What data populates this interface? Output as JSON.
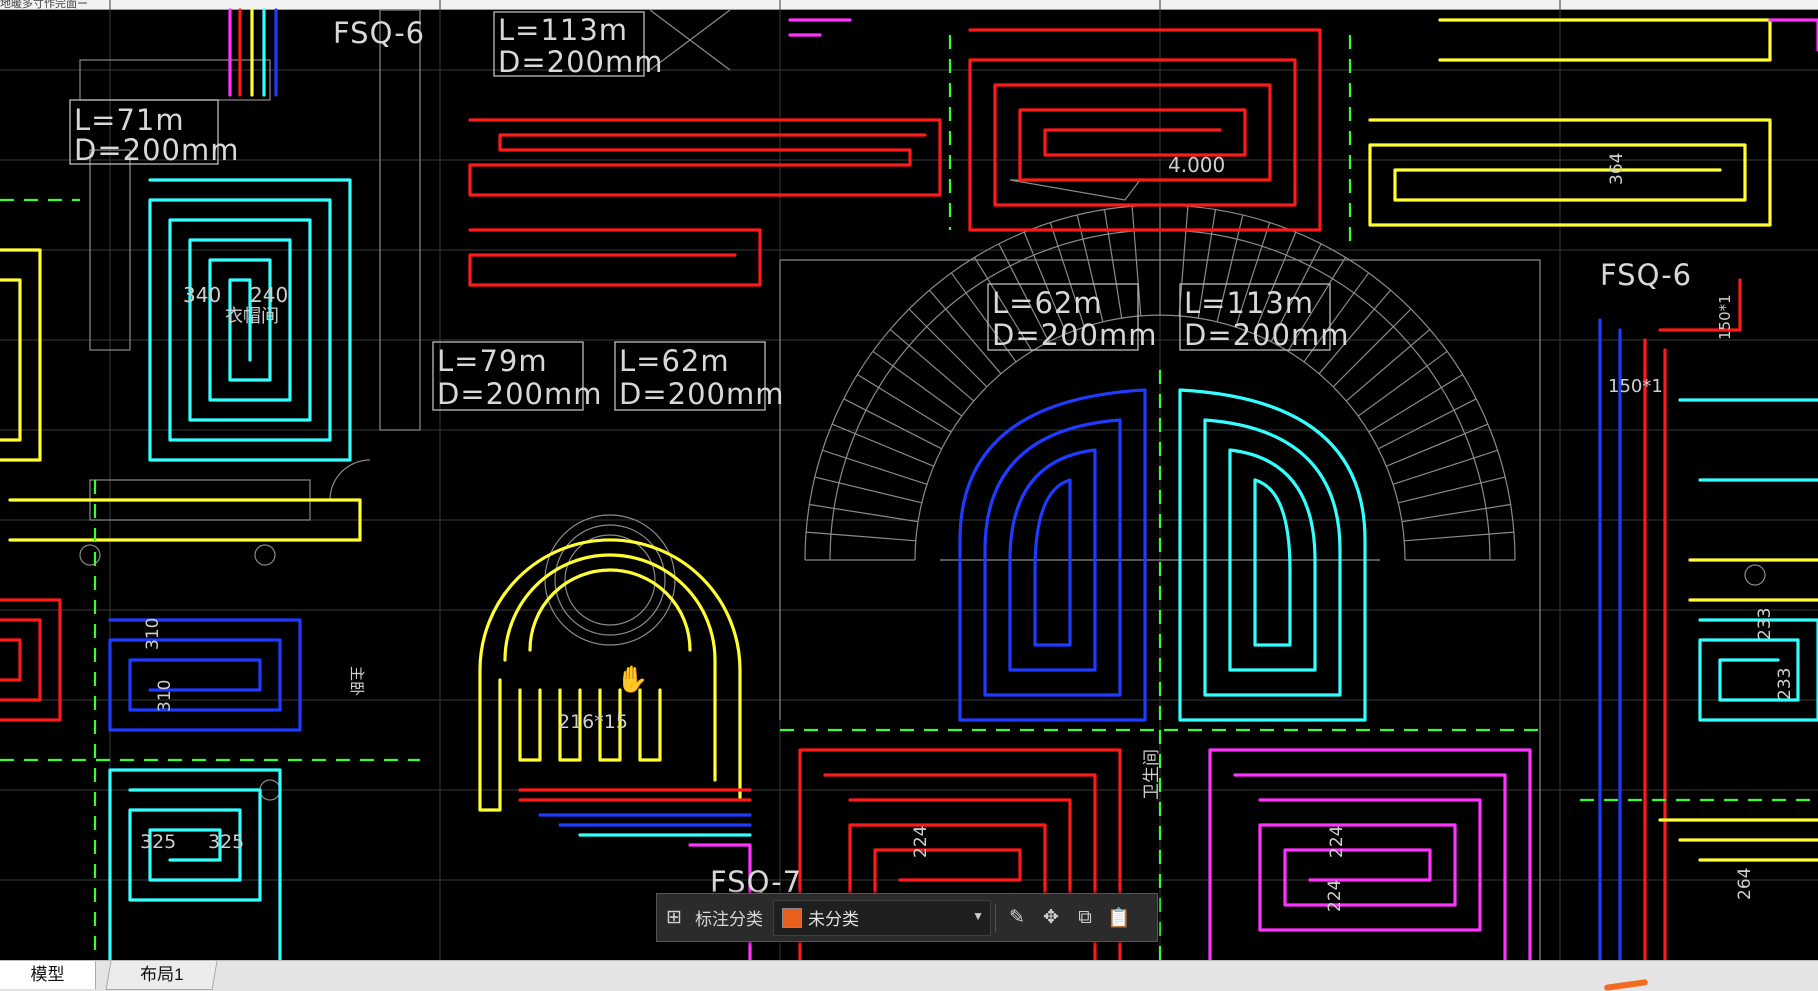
{
  "window": {
    "title_fragment": "地暖多寸作完面ー"
  },
  "drawing": {
    "labels": [
      {
        "length": "L=71m",
        "diameter": "D=200mm"
      },
      {
        "length": "L=113m",
        "diameter": "D=200mm"
      },
      {
        "length": "L=79m",
        "diameter": "D=200mm"
      },
      {
        "length": "L=62m",
        "diameter": "D=200mm"
      },
      {
        "length": "L=62m",
        "diameter": "D=200mm"
      },
      {
        "length": "L=113m",
        "diameter": "D=200mm"
      }
    ],
    "manifolds": [
      "FSQ-6",
      "FSQ-6",
      "FSQ-7"
    ],
    "elevation": "4.000",
    "spacing_marks": [
      "340",
      "240",
      "310",
      "310",
      "325",
      "325",
      "224",
      "224",
      "224",
      "233",
      "233",
      "264",
      "364",
      "150*1",
      "150*1"
    ],
    "room_marks": [
      "衣帽间",
      "主卧",
      "卫生间",
      "216*15"
    ]
  },
  "annotation_toolbar": {
    "label": "标注分类",
    "category": "未分类",
    "category_color": "#e8601c",
    "icons": [
      "grid-icon",
      "edit-icon",
      "move-icon",
      "copy-icon",
      "paste-icon"
    ]
  },
  "tabs": {
    "model": "模型",
    "layout": "布局1"
  },
  "colors": {
    "background": "#000000",
    "red_pipe": "#ff1a1a",
    "yellow_pipe": "#ffff33",
    "cyan_pipe": "#33ffff",
    "blue_pipe": "#1f3bff",
    "magenta_pipe": "#ff33ff",
    "green_dash": "#33ff33",
    "accent": "#f36b20"
  }
}
